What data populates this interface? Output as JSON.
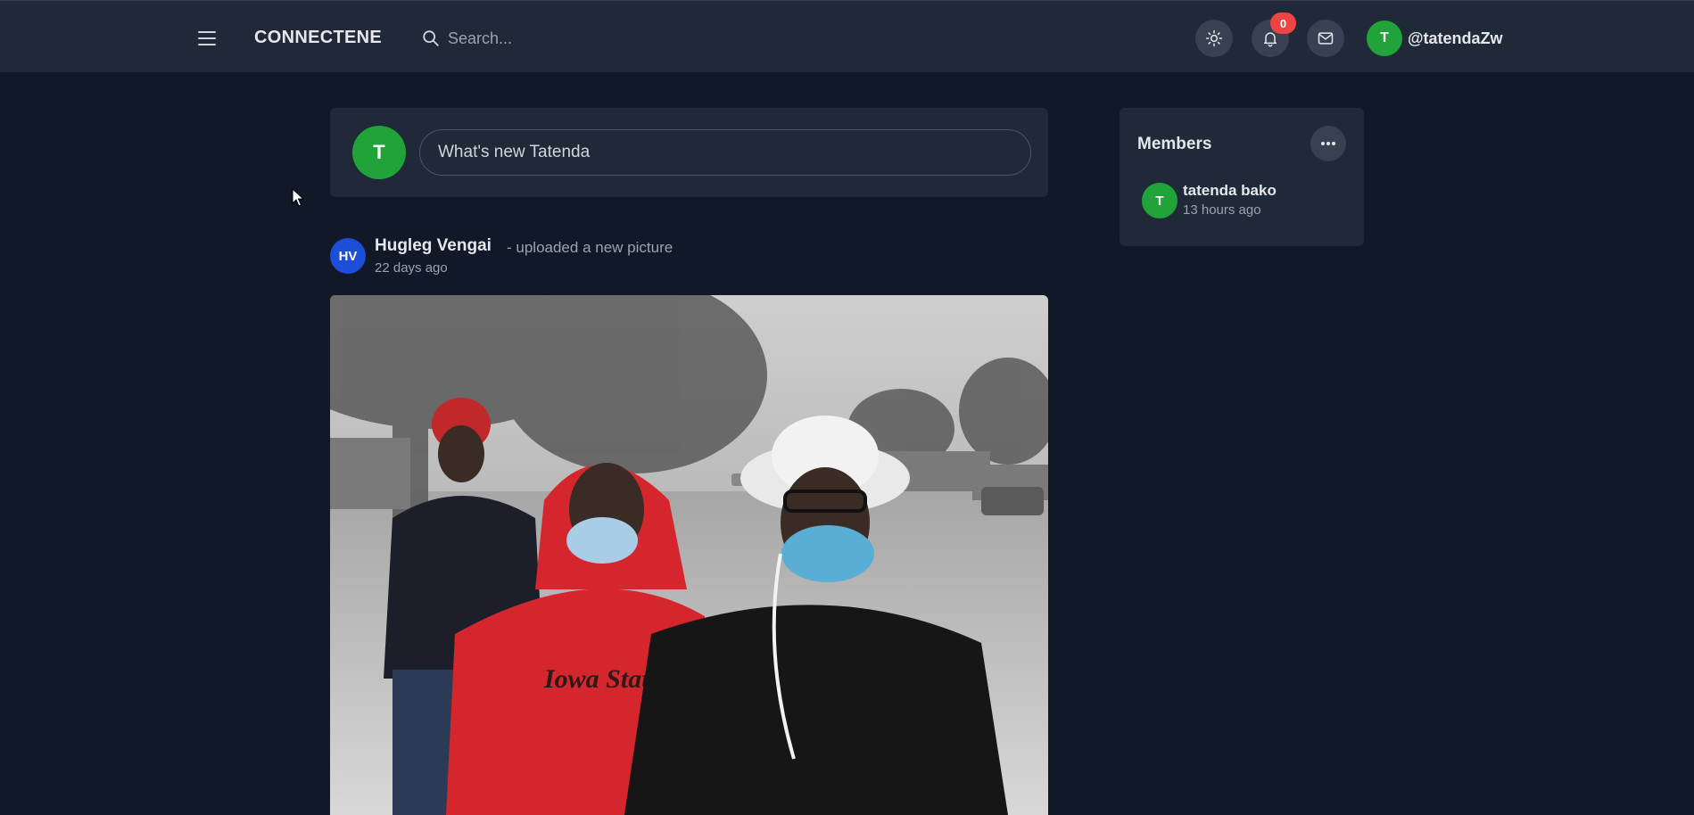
{
  "header": {
    "brand": "CONNECTENE",
    "search_placeholder": "Search...",
    "notification_count": "0",
    "user": {
      "initial": "T",
      "handle": "@tatendaZw"
    },
    "icons": [
      "menu-icon",
      "search-icon",
      "sun-icon",
      "bell-icon",
      "mail-icon"
    ]
  },
  "composer": {
    "avatar_initial": "T",
    "placeholder": "What's new Tatenda"
  },
  "post": {
    "avatar_initials": "HV",
    "author": "Hugleg Vengai",
    "action": "- uploaded a new picture",
    "time": "22 days ago",
    "image_alt": "Three young men wearing face masks outdoors"
  },
  "members": {
    "title": "Members",
    "list": [
      {
        "initial": "T",
        "name": "tatenda bako",
        "time": "13 hours ago"
      }
    ]
  },
  "colors": {
    "page_bg": "#111827",
    "panel_bg": "#1f2937",
    "avatar_green": "#22a33a",
    "avatar_blue": "#1d4ed8",
    "badge_red": "#ef4444"
  }
}
